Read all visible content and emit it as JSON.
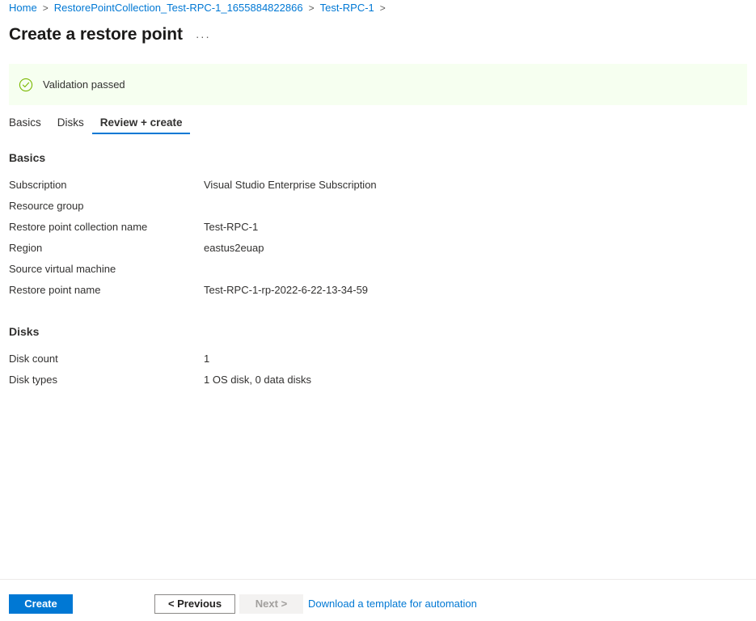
{
  "breadcrumb": {
    "separator": ">",
    "items": [
      {
        "label": "Home"
      },
      {
        "label": "RestorePointCollection_Test-RPC-1_1655884822866"
      },
      {
        "label": "Test-RPC-1"
      }
    ],
    "trailing_separator": ">"
  },
  "header": {
    "title": "Create a restore point",
    "more_actions": "···"
  },
  "banner": {
    "icon": "check-circle-icon",
    "message": "Validation passed",
    "background_color": "#f6fff0",
    "icon_color": "#7ab800"
  },
  "tabs": [
    {
      "label": "Basics",
      "active": false
    },
    {
      "label": "Disks",
      "active": false
    },
    {
      "label": "Review + create",
      "active": true
    }
  ],
  "sections": [
    {
      "heading": "Basics",
      "rows": [
        {
          "label": "Subscription",
          "value": "Visual Studio Enterprise Subscription"
        },
        {
          "label": "Resource group",
          "value": ""
        },
        {
          "label": "Restore point collection name",
          "value": "Test-RPC-1"
        },
        {
          "label": "Region",
          "value": "eastus2euap"
        },
        {
          "label": "Source virtual machine",
          "value": ""
        },
        {
          "label": "Restore point name",
          "value": "Test-RPC-1-rp-2022-6-22-13-34-59"
        }
      ]
    },
    {
      "heading": "Disks",
      "rows": [
        {
          "label": "Disk count",
          "value": "1"
        },
        {
          "label": "Disk types",
          "value": "1 OS disk, 0 data disks"
        }
      ]
    }
  ],
  "footer": {
    "create_label": "Create",
    "previous_label": "< Previous",
    "next_label": "Next >",
    "template_link_label": "Download a template for automation"
  },
  "colors": {
    "accent": "#0078d4",
    "link": "#0078d4",
    "text": "#323130",
    "success": "#7ab800",
    "banner_bg": "#f6fff0"
  }
}
